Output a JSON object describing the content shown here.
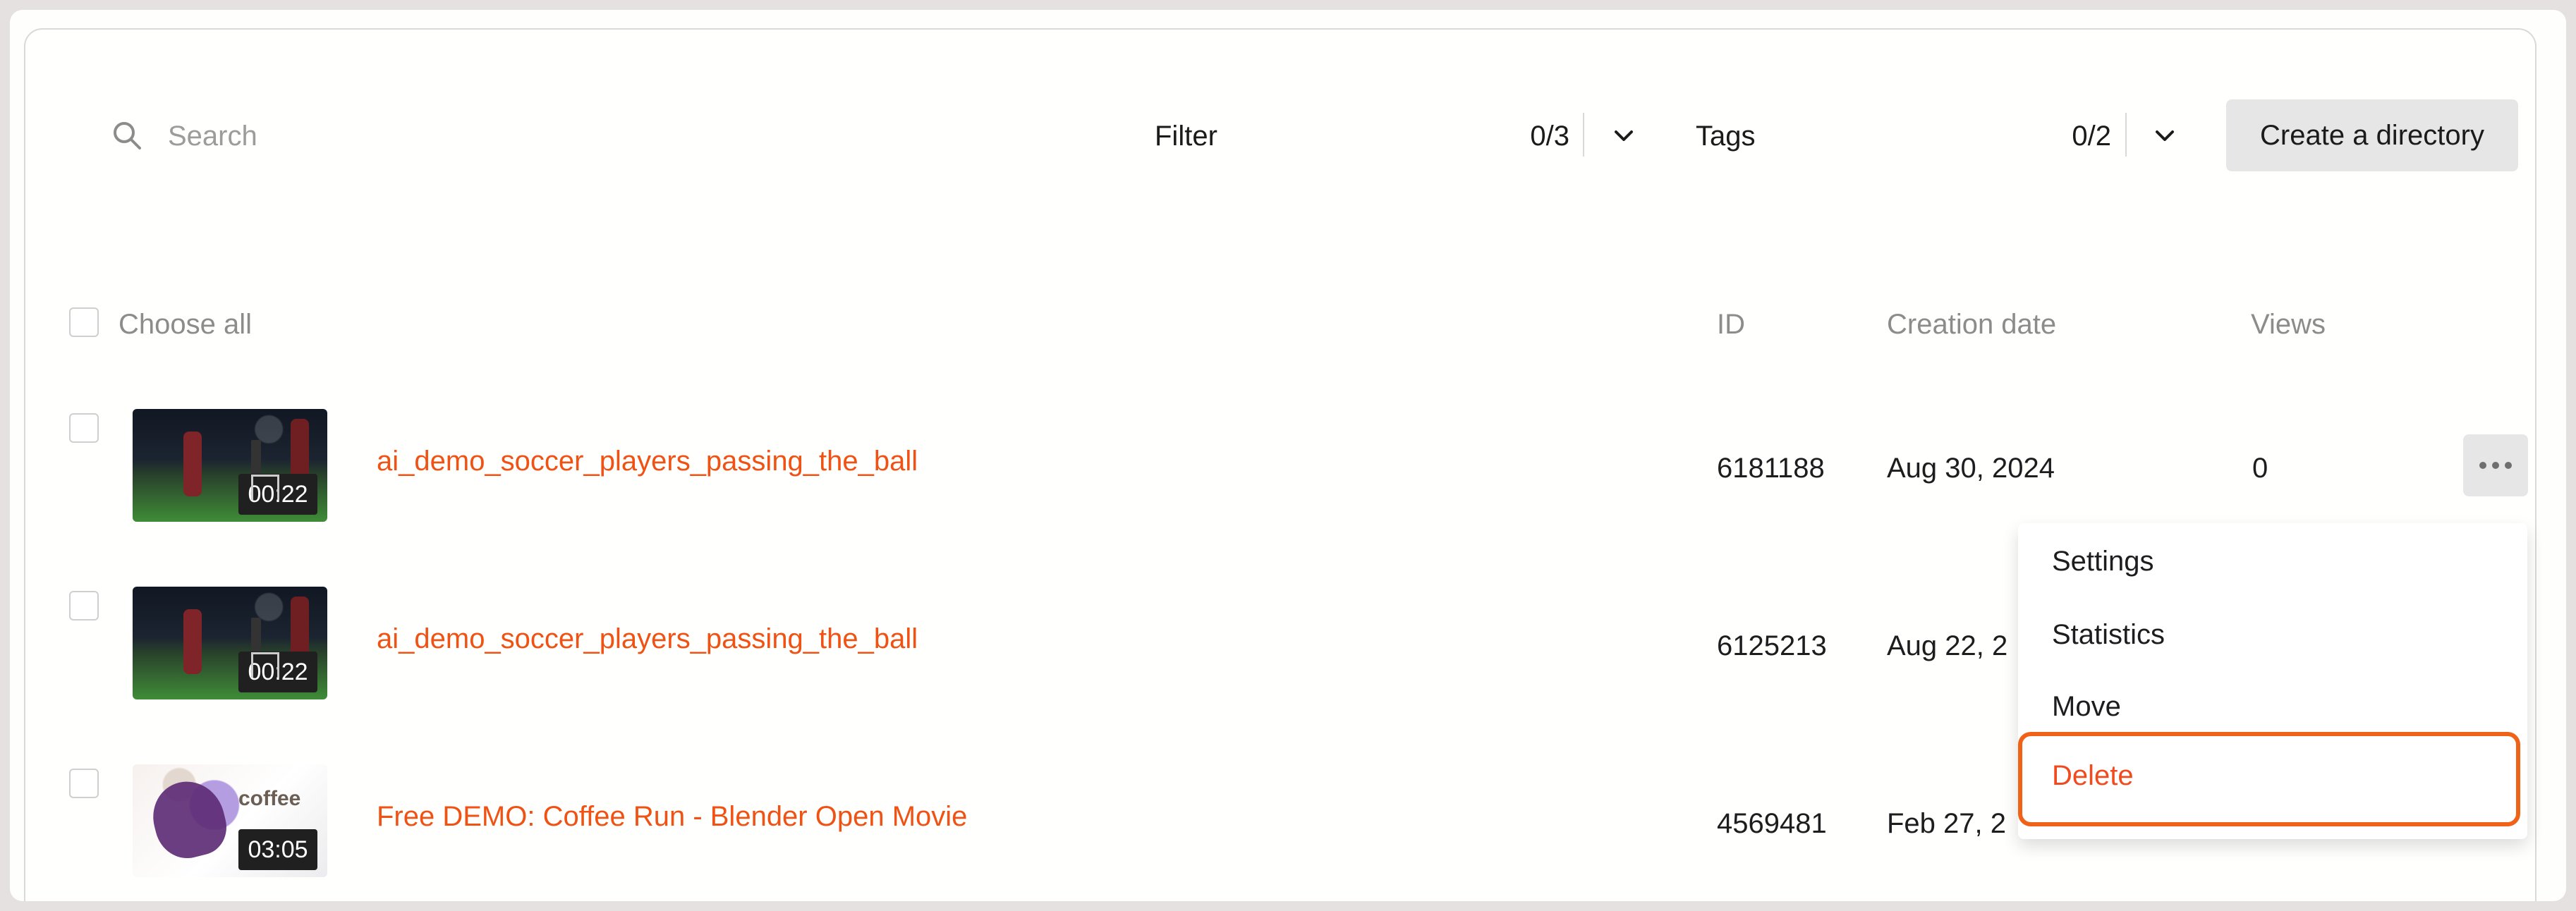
{
  "search": {
    "placeholder": "Search"
  },
  "toolbar": {
    "filter_label": "Filter",
    "filter_count": "0/3",
    "tags_label": "Tags",
    "tags_count": "0/2",
    "create_label": "Create a directory"
  },
  "table": {
    "headers": {
      "choose_all": "Choose all",
      "id": "ID",
      "creation_date": "Creation date",
      "views": "Views"
    },
    "rows": [
      {
        "title": "ai_demo_soccer_players_passing_the_ball",
        "duration": "00:22",
        "id": "6181188",
        "date": "Aug 30, 2024",
        "views": "0",
        "thumbnail": "soccer"
      },
      {
        "title": "ai_demo_soccer_players_passing_the_ball",
        "duration": "00:22",
        "id": "6125213",
        "date": "Aug 22, 2",
        "views": "",
        "thumbnail": "soccer"
      },
      {
        "title": "Free DEMO: Coffee Run - Blender Open Movie",
        "duration": "03:05",
        "id": "4569481",
        "date": "Feb 27, 2",
        "views": "",
        "thumbnail": "coffee",
        "thumbnail_text": "coffee"
      }
    ]
  },
  "menu": {
    "items": [
      "Settings",
      "Statistics",
      "Move",
      "Delete"
    ]
  },
  "colors": {
    "accent": "#F05214",
    "menu_highlight": "#F16219",
    "button_gray": "#E6E6E6",
    "muted_text": "#8C8C8C"
  },
  "icons": {
    "search": "search-icon",
    "dropdown": "chevron-down-icon",
    "more": "more-icon",
    "checkbox": "checkbox-icon"
  }
}
